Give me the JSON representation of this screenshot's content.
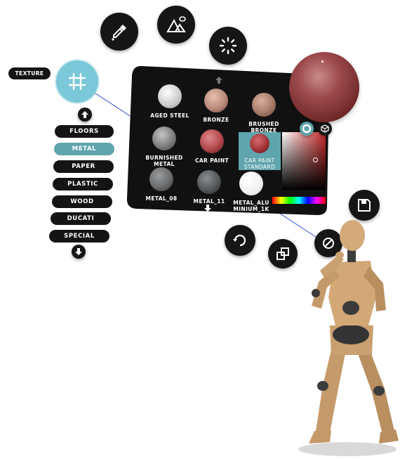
{
  "texture_tag": "TEXTURE",
  "categories": [
    "FLOORS",
    "METAL",
    "PAPER",
    "PLASTIC",
    "WOOD",
    "DUCATI",
    "SPECIAL"
  ],
  "active_category": "METAL",
  "materials": [
    {
      "label": "AGED STEEL",
      "color": "#d9dada"
    },
    {
      "label": "BRONZE",
      "color": "#b88a7a"
    },
    {
      "label": "BRUSHED BRONZE",
      "color": "#a67b6a"
    },
    {
      "label": "BURNISHED METAL",
      "color": "#7e7f80"
    },
    {
      "label": "CAR PAINT",
      "color": "#b1474a"
    },
    {
      "label": "CAR PAINT STANDARD",
      "color": "#a33438"
    },
    {
      "label": "METAL_08",
      "color": "#6a6c6e"
    },
    {
      "label": "METAL_11",
      "color": "#55585a"
    },
    {
      "label": "METAL_ALUMINIUM_1K",
      "color": "#f2f2f2"
    }
  ],
  "colors": {
    "panel": "#111111",
    "accent": "#5fa5ad",
    "grid_button": "#7ac8d8",
    "preview_sphere": "#8c3a3c"
  },
  "icons": {
    "top": [
      "eyedropper-icon",
      "mountain-image-icon",
      "loading-spinner-icon"
    ],
    "side": [
      "grid-icon"
    ],
    "bottom": [
      "rotate-icon",
      "swap-layers-icon",
      "no-entry-icon",
      "save-disk-icon"
    ]
  }
}
